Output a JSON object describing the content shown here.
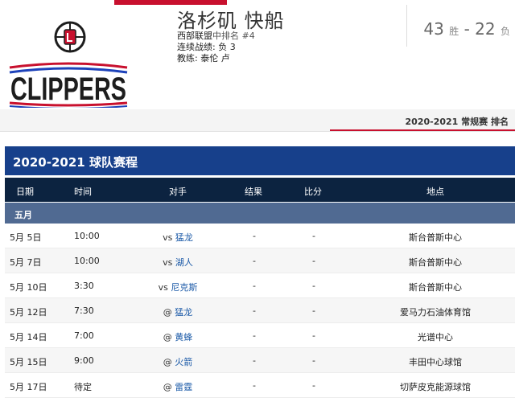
{
  "team": {
    "name": "洛杉矶 快船",
    "conf_label": "西部联盟",
    "rank_text": "中排名 #4",
    "streak_label": "连续战绩:",
    "streak_value": "负 3",
    "coach_label": "教练:",
    "coach_value": "泰伦 卢",
    "wins": "43",
    "wins_unit": "胜",
    "dash": "-",
    "losses": "22",
    "losses_unit": "负",
    "logo_text": "CLIPPERS"
  },
  "rank_link": "2020-2021 常规赛 排名",
  "schedule_title": "2020-2021 球队赛程",
  "columns": [
    "日期",
    "时间",
    "对手",
    "结果",
    "比分",
    "地点"
  ],
  "month": "五月",
  "games": [
    {
      "date": "5月 5日",
      "time": "10:00",
      "prefix": "vs",
      "opponent": "猛龙",
      "result": "-",
      "score": "-",
      "venue": "斯台普斯中心"
    },
    {
      "date": "5月 7日",
      "time": "10:00",
      "prefix": "vs",
      "opponent": "湖人",
      "result": "-",
      "score": "-",
      "venue": "斯台普斯中心"
    },
    {
      "date": "5月 10日",
      "time": "3:30",
      "prefix": "vs",
      "opponent": "尼克斯",
      "result": "-",
      "score": "-",
      "venue": "斯台普斯中心"
    },
    {
      "date": "5月 12日",
      "time": "7:30",
      "prefix": "@",
      "opponent": "猛龙",
      "result": "-",
      "score": "-",
      "venue": "爱马力石油体育馆"
    },
    {
      "date": "5月 14日",
      "time": "7:00",
      "prefix": "@",
      "opponent": "黄蜂",
      "result": "-",
      "score": "-",
      "venue": "光谱中心"
    },
    {
      "date": "5月 15日",
      "time": "9:00",
      "prefix": "@",
      "opponent": "火箭",
      "result": "-",
      "score": "-",
      "venue": "丰田中心球馆"
    },
    {
      "date": "5月 17日",
      "time": "待定",
      "prefix": "@",
      "opponent": "雷霆",
      "result": "-",
      "score": "-",
      "venue": "切萨皮克能源球馆"
    }
  ],
  "colors": {
    "brand_red": "#c8102e",
    "brand_blue": "#17408b",
    "header_navy": "#0c2340",
    "month_blue": "#506a92",
    "link_blue": "#1d5ba8"
  }
}
